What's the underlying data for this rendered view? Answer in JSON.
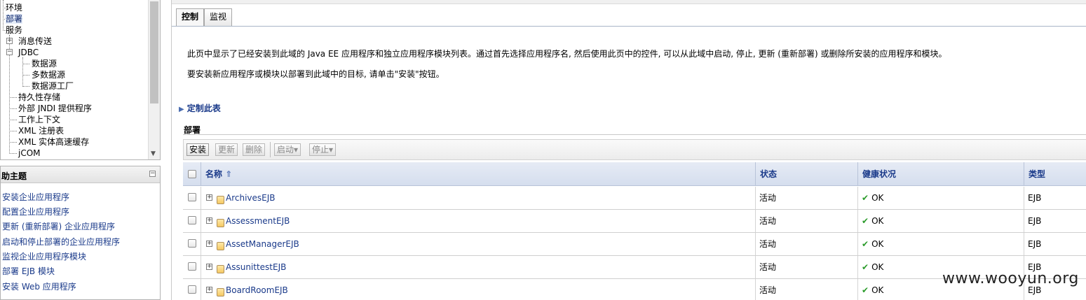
{
  "tree": {
    "items": [
      {
        "label": "环境"
      },
      {
        "label": "部署"
      },
      {
        "label": "服务"
      },
      {
        "label": "消息传送"
      },
      {
        "label": "JDBC"
      },
      {
        "label": "数据源"
      },
      {
        "label": "多数据源"
      },
      {
        "label": "数据源工厂"
      },
      {
        "label": "持久性存储"
      },
      {
        "label": "外部 JNDI 提供程序"
      },
      {
        "label": "工作上下文"
      },
      {
        "label": "XML 注册表"
      },
      {
        "label": "XML 实体高速缓存"
      },
      {
        "label": "jCOM"
      }
    ],
    "expand_plus": "⊞",
    "expand_minus": "⊟"
  },
  "help": {
    "title": "助主题",
    "collapse_glyph": "−",
    "links": [
      "安装企业应用程序",
      "配置企业应用程序",
      "更新 (重新部署) 企业应用程序",
      "启动和停止部署的企业应用程序",
      "监视企业应用程序模块",
      "部署 EJB 模块",
      "安装 Web 应用程序"
    ]
  },
  "tabs": [
    {
      "label": "控制"
    },
    {
      "label": "监视"
    }
  ],
  "description": {
    "line1": "此页中显示了已经安装到此域的 Java EE 应用程序和独立应用程序模块列表。通过首先选择应用程序名, 然后使用此页中的控件, 可以从此域中启动, 停止, 更新 (重新部署) 或删除所安装的应用程序和模块。",
    "line2": "要安装新应用程序或模块以部署到此域中的目标, 请单击\"安装\"按钮。"
  },
  "customize_label": "定制此表",
  "section_title": "部署",
  "toolbar": {
    "install": "安装",
    "update": "更新",
    "delete": "删除",
    "start": "启动",
    "stop": "停止",
    "dropdown_arrow": "▾"
  },
  "table": {
    "columns": {
      "name": "名称",
      "sort_icon": "⇑",
      "state": "状态",
      "health": "健康状况",
      "type": "类型"
    },
    "rows": [
      {
        "name": "ArchivesEJB",
        "state": "活动",
        "health": "OK",
        "type": "EJB"
      },
      {
        "name": "AssessmentEJB",
        "state": "活动",
        "health": "OK",
        "type": "EJB"
      },
      {
        "name": "AssetManagerEJB",
        "state": "活动",
        "health": "OK",
        "type": "EJB"
      },
      {
        "name": "AssunittestEJB",
        "state": "活动",
        "health": "OK",
        "type": "EJB"
      },
      {
        "name": "BoardRoomEJB",
        "state": "活动",
        "health": "OK",
        "type": "EJB"
      }
    ],
    "ok_glyph": "✔"
  },
  "watermark": "www.wooyun.org",
  "colors": {
    "link": "#1a3a8a",
    "header_bg": "#d5deee",
    "ok_green": "#2b9b2b"
  }
}
